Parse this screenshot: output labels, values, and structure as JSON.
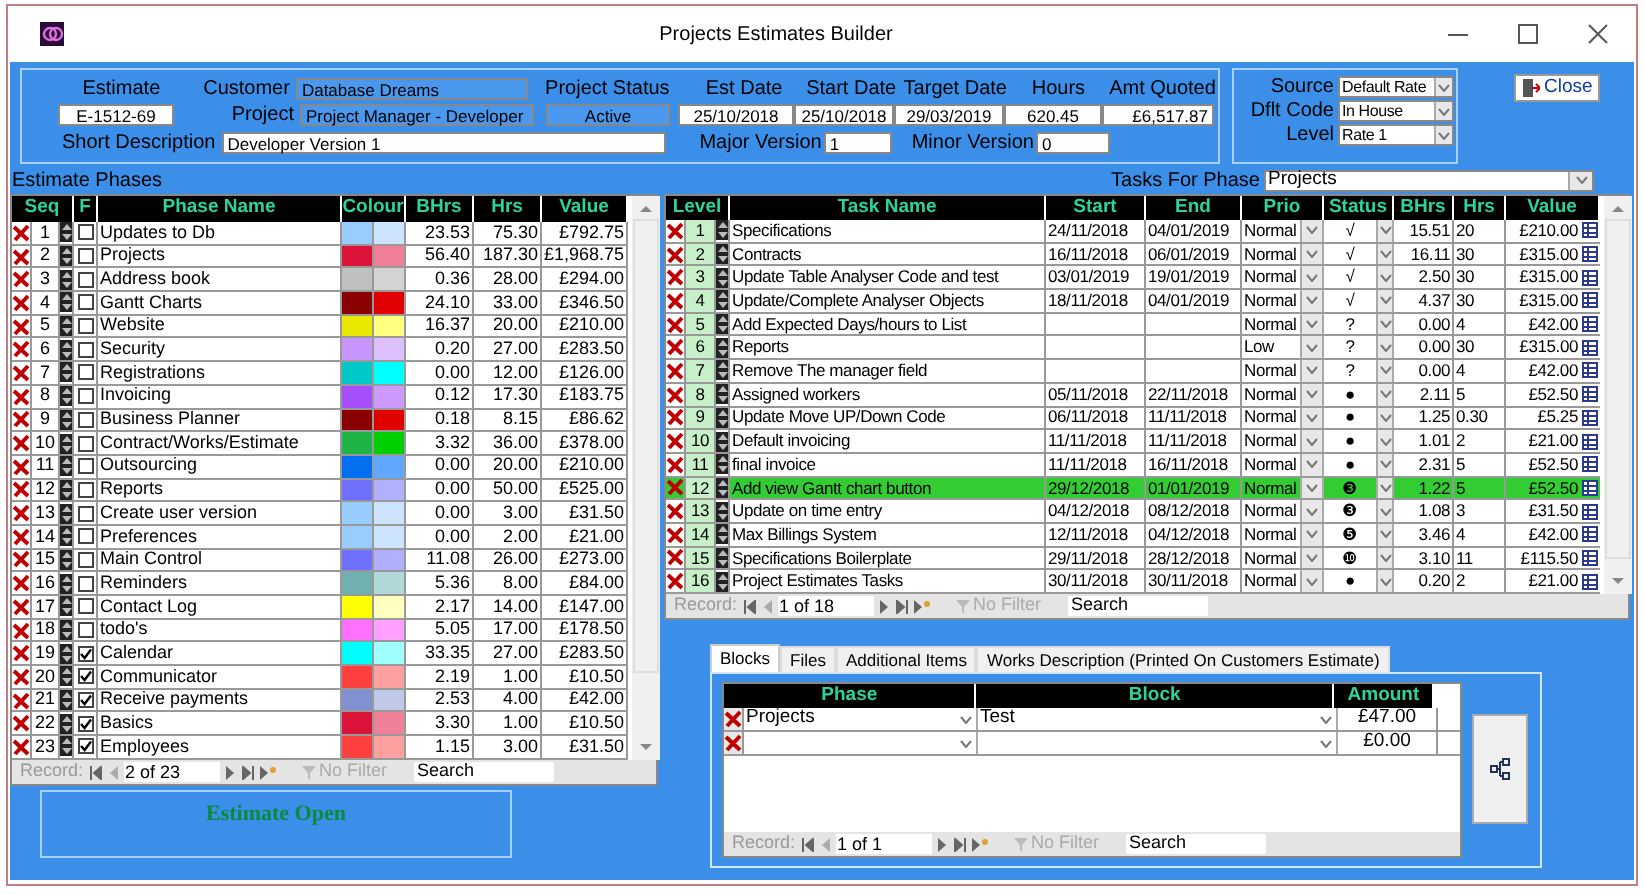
{
  "window": {
    "title": "Projects Estimates Builder"
  },
  "header": {
    "estimate_label": "Estimate",
    "estimate": "E-1512-69",
    "customer_label": "Customer",
    "customer": "Database Dreams",
    "project_label": "Project",
    "project": "Project Manager - Developer",
    "status_label": "Project Status",
    "status": "Active",
    "dates": [
      {
        "label": "Est Date",
        "value": "25/10/2018"
      },
      {
        "label": "Start Date",
        "value": "25/10/2018"
      },
      {
        "label": "Target Date",
        "value": "29/03/2019"
      },
      {
        "label": "Hours",
        "value": "620.45"
      },
      {
        "label": "Amt Quoted",
        "value": "£6,517.87"
      }
    ],
    "short_description_label": "Short Description",
    "short_description": "Developer Version 1",
    "major_version_label": "Major Version",
    "major_version": "1",
    "minor_version_label": "Minor Version",
    "minor_version": "0"
  },
  "rate_settings": [
    {
      "label": "Source",
      "value": "Default Rate"
    },
    {
      "label": "Dflt Code",
      "value": "In House"
    },
    {
      "label": "Level",
      "value": "Rate 1"
    }
  ],
  "close_button": "Close",
  "phases_label": "Estimate Phases",
  "tasks_for_phase": {
    "label": "Tasks For Phase",
    "value": "Projects"
  },
  "phases": {
    "columns": [
      "Seq",
      "F",
      "Phase Name",
      "Colour",
      "BHrs",
      "Hrs",
      "Value"
    ],
    "rows": [
      {
        "seq": "1",
        "final": false,
        "name": "Updates to Db",
        "swatches": [
          {
            "color": "#99ccff"
          },
          {
            "color": "#cce4ff"
          }
        ],
        "bhrs": "23.53",
        "hrs": "75.30",
        "value": "£792.75"
      },
      {
        "seq": "2",
        "final": false,
        "name": "Projects",
        "swatches": [
          {
            "color": "#dc143c"
          },
          {
            "color": "#f08098"
          }
        ],
        "bhrs": "56.40",
        "hrs": "187.30",
        "value": "£1,968.75"
      },
      {
        "seq": "3",
        "final": false,
        "name": "Address book",
        "swatches": [
          {
            "color": "#c0c0c0"
          },
          {
            "color": "#d3d3d3"
          }
        ],
        "bhrs": "0.36",
        "hrs": "28.00",
        "value": "£294.00"
      },
      {
        "seq": "4",
        "final": false,
        "name": "Gantt Charts",
        "swatches": [
          {
            "color": "#8b0000"
          },
          {
            "color": "#e00000"
          }
        ],
        "bhrs": "24.10",
        "hrs": "33.00",
        "value": "£346.50"
      },
      {
        "seq": "5",
        "final": false,
        "name": "Website",
        "swatches": [
          {
            "color": "#e8e800"
          },
          {
            "color": "#ffff80"
          }
        ],
        "bhrs": "16.37",
        "hrs": "20.00",
        "value": "£210.00"
      },
      {
        "seq": "6",
        "final": false,
        "name": "Security",
        "swatches": [
          {
            "color": "#c896ff"
          },
          {
            "color": "#dcc0ff"
          }
        ],
        "bhrs": "0.20",
        "hrs": "27.00",
        "value": "£283.50"
      },
      {
        "seq": "7",
        "final": false,
        "name": "Registrations",
        "swatches": [
          {
            "color": "#00c8c8"
          },
          {
            "color": "#00ffff"
          }
        ],
        "bhrs": "0.00",
        "hrs": "12.00",
        "value": "£126.00"
      },
      {
        "seq": "8",
        "final": false,
        "name": "Invoicing",
        "swatches": [
          {
            "color": "#a64dff"
          },
          {
            "color": "#cc99ff"
          }
        ],
        "bhrs": "0.12",
        "hrs": "17.30",
        "value": "£183.75"
      },
      {
        "seq": "9",
        "final": false,
        "name": "Business Planner",
        "swatches": [
          {
            "color": "#8b0000"
          },
          {
            "color": "#e00000"
          }
        ],
        "bhrs": "0.18",
        "hrs": "8.15",
        "value": "£86.62"
      },
      {
        "seq": "10",
        "final": false,
        "name": "Contract/Works/Estimate",
        "swatches": [
          {
            "color": "#1eb446"
          },
          {
            "color": "#00d000"
          }
        ],
        "bhrs": "3.32",
        "hrs": "36.00",
        "value": "£378.00"
      },
      {
        "seq": "11",
        "final": false,
        "name": "Outsourcing",
        "swatches": [
          {
            "color": "#0070f0"
          },
          {
            "color": "#60a8ff"
          }
        ],
        "bhrs": "0.00",
        "hrs": "20.00",
        "value": "£210.00"
      },
      {
        "seq": "12",
        "final": false,
        "name": "Reports",
        "swatches": [
          {
            "color": "#7070ff"
          },
          {
            "color": "#b0b0ff"
          }
        ],
        "bhrs": "0.00",
        "hrs": "50.00",
        "value": "£525.00"
      },
      {
        "seq": "13",
        "final": false,
        "name": "Create user version",
        "swatches": [
          {
            "color": "#99ccff"
          },
          {
            "color": "#cce4ff"
          }
        ],
        "bhrs": "0.00",
        "hrs": "3.00",
        "value": "£31.50"
      },
      {
        "seq": "14",
        "final": false,
        "name": "Preferences",
        "swatches": [
          {
            "color": "#99ccff"
          },
          {
            "color": "#cce4ff"
          }
        ],
        "bhrs": "0.00",
        "hrs": "2.00",
        "value": "£21.00"
      },
      {
        "seq": "15",
        "final": false,
        "name": "Main Control",
        "swatches": [
          {
            "color": "#7070ff"
          },
          {
            "color": "#b0b0ff"
          }
        ],
        "bhrs": "11.08",
        "hrs": "26.00",
        "value": "£273.00"
      },
      {
        "seq": "16",
        "final": false,
        "name": "Reminders",
        "swatches": [
          {
            "color": "#70b0b0"
          },
          {
            "color": "#b0d8d8"
          }
        ],
        "bhrs": "5.36",
        "hrs": "8.00",
        "value": "£84.00"
      },
      {
        "seq": "17",
        "final": false,
        "name": "Contact Log",
        "swatches": [
          {
            "color": "#ffff00"
          },
          {
            "color": "#ffffc0"
          }
        ],
        "bhrs": "2.17",
        "hrs": "14.00",
        "value": "£147.00"
      },
      {
        "seq": "18",
        "final": false,
        "name": "todo's",
        "swatches": [
          {
            "color": "#ff70ff"
          },
          {
            "color": "#ffa0ff"
          }
        ],
        "bhrs": "5.05",
        "hrs": "17.00",
        "value": "£178.50"
      },
      {
        "seq": "19",
        "final": true,
        "name": "Calendar",
        "swatches": [
          {
            "color": "#00ffff"
          },
          {
            "color": "#a0ffff"
          }
        ],
        "bhrs": "33.35",
        "hrs": "27.00",
        "value": "£283.50"
      },
      {
        "seq": "20",
        "final": true,
        "name": "Communicator",
        "swatches": [
          {
            "color": "#ff4040"
          },
          {
            "color": "#ffa0a0"
          }
        ],
        "bhrs": "2.19",
        "hrs": "1.00",
        "value": "£10.50"
      },
      {
        "seq": "21",
        "final": true,
        "name": "Receive payments",
        "swatches": [
          {
            "color": "#8090d0"
          },
          {
            "color": "#c0c8e8"
          }
        ],
        "bhrs": "2.53",
        "hrs": "4.00",
        "value": "£42.00"
      },
      {
        "seq": "22",
        "final": true,
        "name": "Basics",
        "swatches": [
          {
            "color": "#dc143c"
          },
          {
            "color": "#f08098"
          }
        ],
        "bhrs": "3.30",
        "hrs": "1.00",
        "value": "£10.50"
      },
      {
        "seq": "23",
        "final": true,
        "name": "Employees",
        "swatches": [
          {
            "color": "#ff4040"
          },
          {
            "color": "#ffa0a0"
          }
        ],
        "bhrs": "1.15",
        "hrs": "3.00",
        "value": "£31.50"
      }
    ],
    "record": {
      "label": "Record:",
      "position": "2 of 23",
      "filter": "No Filter",
      "search_placeholder": "Search"
    }
  },
  "estimate_status": "Estimate Open",
  "tasks": {
    "columns": [
      "Level",
      "Task Name",
      "Start",
      "End",
      "Prio",
      "Status",
      "BHrs",
      "Hrs",
      "Value"
    ],
    "rows": [
      {
        "level": "1",
        "name": "Specifications",
        "start": "24/11/2018",
        "end": "04/01/2019",
        "prio": "Normal",
        "status": "√",
        "bhrs": "15.51",
        "hrs": "20",
        "value": "£210.00",
        "selected": false
      },
      {
        "level": "2",
        "name": "Contracts",
        "start": "16/11/2018",
        "end": "06/01/2019",
        "prio": "Normal",
        "status": "√",
        "bhrs": "16.11",
        "hrs": "30",
        "value": "£315.00",
        "selected": false
      },
      {
        "level": "3",
        "name": "Update Table Analyser Code and test",
        "start": "03/01/2019",
        "end": "19/01/2019",
        "prio": "Normal",
        "status": "√",
        "bhrs": "2.50",
        "hrs": "30",
        "value": "£315.00",
        "selected": false
      },
      {
        "level": "4",
        "name": "Update/Complete Analyser Objects",
        "start": "18/11/2018",
        "end": "04/01/2019",
        "prio": "Normal",
        "status": "√",
        "bhrs": "4.37",
        "hrs": "30",
        "value": "£315.00",
        "selected": false
      },
      {
        "level": "5",
        "name": "Add Expected Days/hours to List",
        "prio": "Normal",
        "status": "?",
        "bhrs": "0.00",
        "hrs": "4",
        "value": "£42.00",
        "selected": false
      },
      {
        "level": "6",
        "name": "Reports",
        "prio": "Low",
        "status": "?",
        "bhrs": "0.00",
        "hrs": "30",
        "value": "£315.00",
        "selected": false
      },
      {
        "level": "7",
        "name": "Remove The manager field",
        "prio": "Normal",
        "status": "?",
        "bhrs": "0.00",
        "hrs": "4",
        "value": "£42.00",
        "selected": false
      },
      {
        "level": "8",
        "name": "Assigned workers",
        "start": "05/11/2018",
        "end": "22/11/2018",
        "prio": "Normal",
        "status": "●",
        "bhrs": "2.11",
        "hrs": "5",
        "value": "£52.50",
        "selected": false
      },
      {
        "level": "9",
        "name": "Update Move UP/Down Code",
        "start": "06/11/2018",
        "end": "11/11/2018",
        "prio": "Normal",
        "status": "●",
        "bhrs": "1.25",
        "hrs": "0.30",
        "value": "£5.25",
        "selected": false
      },
      {
        "level": "10",
        "name": "Default invoicing",
        "start": "11/11/2018",
        "end": "11/11/2018",
        "prio": "Normal",
        "status": "●",
        "bhrs": "1.01",
        "hrs": "2",
        "value": "£21.00",
        "selected": false
      },
      {
        "level": "11",
        "name": "final invoice",
        "start": "11/11/2018",
        "end": "16/11/2018",
        "prio": "Normal",
        "status": "●",
        "bhrs": "2.31",
        "hrs": "5",
        "value": "£52.50",
        "selected": false
      },
      {
        "level": "12",
        "name": "Add view Gantt chart button",
        "start": "29/12/2018",
        "end": "01/01/2019",
        "prio": "Normal",
        "status": "❸",
        "bhrs": "1.22",
        "hrs": "5",
        "value": "£52.50",
        "selected": true
      },
      {
        "level": "13",
        "name": "Update on time entry",
        "start": "04/12/2018",
        "end": "08/12/2018",
        "prio": "Normal",
        "status": "❸",
        "bhrs": "1.08",
        "hrs": "3",
        "value": "£31.50",
        "selected": false
      },
      {
        "level": "14",
        "name": "Max Billings System",
        "start": "12/11/2018",
        "end": "04/12/2018",
        "prio": "Normal",
        "status": "❺",
        "bhrs": "3.46",
        "hrs": "4",
        "value": "£42.00",
        "selected": false
      },
      {
        "level": "15",
        "name": "Specifications Boilerplate",
        "start": "29/11/2018",
        "end": "28/12/2018",
        "prio": "Normal",
        "status": "❿",
        "bhrs": "3.10",
        "hrs": "11",
        "value": "£115.50",
        "selected": false
      },
      {
        "level": "16",
        "name": "Project Estimates Tasks",
        "start": "30/11/2018",
        "end": "30/11/2018",
        "prio": "Normal",
        "status": "●",
        "bhrs": "0.20",
        "hrs": "2",
        "value": "£21.00",
        "selected": false
      }
    ],
    "record": {
      "label": "Record:",
      "position": "1 of 18",
      "filter": "No Filter",
      "search_placeholder": "Search"
    }
  },
  "detail_tabs": [
    {
      "label": "Blocks",
      "selected": true
    },
    {
      "label": "Files",
      "selected": false
    },
    {
      "label": "Additional Items",
      "selected": false
    },
    {
      "label": "Works Description (Printed On Customers Estimate)",
      "selected": false
    }
  ],
  "blocks": {
    "columns": [
      "Phase",
      "Block",
      "Amount"
    ],
    "rows": [
      {
        "phase": "Projects",
        "block": "Test",
        "amount": "£47.00"
      },
      {
        "amount": "£0.00"
      }
    ],
    "record": {
      "label": "Record:",
      "position": "1 of 1",
      "filter": "No Filter",
      "search_placeholder": "Search"
    }
  }
}
